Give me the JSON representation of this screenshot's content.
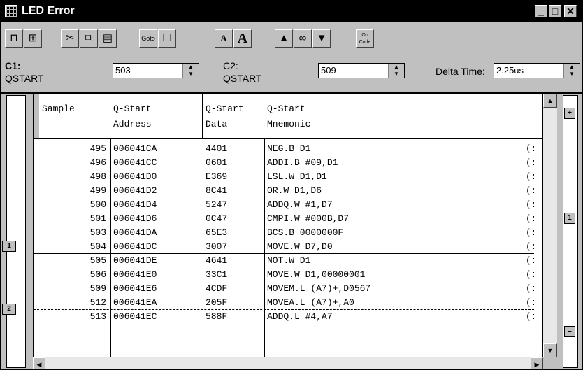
{
  "window": {
    "title": "LED Error"
  },
  "cursor": {
    "c1_label": "C1:",
    "c1_sub": "QSTART",
    "c1_value": "503",
    "c2_label": "C2:",
    "c2_sub": "QSTART",
    "c2_value": "509",
    "delta_label": "Delta Time:",
    "delta_value": "2.25us"
  },
  "columns": [
    {
      "l1": "",
      "l2": "Sample"
    },
    {
      "l1": "Q-Start",
      "l2": "Address"
    },
    {
      "l1": "Q-Start",
      "l2": "Data"
    },
    {
      "l1": "Q-Start",
      "l2": "Mnemonic"
    }
  ],
  "rows": [
    {
      "sample": "495",
      "address": "006041CA",
      "data": "4401",
      "mnemonic": "NEG.B D1",
      "extra": "(:"
    },
    {
      "sample": "496",
      "address": "006041CC",
      "data": "0601",
      "mnemonic": "ADDI.B #09,D1",
      "extra": "(:"
    },
    {
      "sample": "498",
      "address": "006041D0",
      "data": "E369",
      "mnemonic": "LSL.W D1,D1",
      "extra": "(:"
    },
    {
      "sample": "499",
      "address": "006041D2",
      "data": "8C41",
      "mnemonic": "OR.W D1,D6",
      "extra": "(:"
    },
    {
      "sample": "500",
      "address": "006041D4",
      "data": "5247",
      "mnemonic": "ADDQ.W #1,D7",
      "extra": "(:"
    },
    {
      "sample": "501",
      "address": "006041D6",
      "data": "0C47",
      "mnemonic": "CMPI.W #000B,D7",
      "extra": "(:"
    },
    {
      "sample": "503",
      "address": "006041DA",
      "data": "65E3",
      "mnemonic": "BCS.B 0000000F",
      "extra": "(:"
    },
    {
      "sample": "504",
      "address": "006041DC",
      "data": "3007",
      "mnemonic": "MOVE.W D7,D0",
      "extra": "(:"
    },
    {
      "sample": "505",
      "address": "006041DE",
      "data": "4641",
      "mnemonic": "NOT.W D1",
      "extra": "(:"
    },
    {
      "sample": "506",
      "address": "006041E0",
      "data": "33C1",
      "mnemonic": "MOVE.W D1,00000001",
      "extra": "(:"
    },
    {
      "sample": "509",
      "address": "006041E6",
      "data": "4CDF",
      "mnemonic": "MOVEM.L (A7)+,D0567",
      "extra": "(:"
    },
    {
      "sample": "512",
      "address": "006041EA",
      "data": "205F",
      "mnemonic": "MOVEA.L (A7)+,A0",
      "extra": "(:"
    },
    {
      "sample": "513",
      "address": "006041EC",
      "data": "588F",
      "mnemonic": "ADDQ.L #4,A7",
      "extra": "(:"
    }
  ],
  "markers": {
    "m1": "1",
    "m2": "2"
  },
  "toolbar": {
    "font_small": "A",
    "font_large": "A",
    "goto": "Goto",
    "opcode": "Op Code"
  },
  "icons": [
    "window-menu-icon",
    "minimize-icon",
    "maximize-icon",
    "close-icon",
    "insert-column-icon",
    "add-column-icon",
    "cut-icon",
    "copy-icon",
    "paste-icon",
    "goto-icon",
    "properties-icon",
    "font-small-icon",
    "font-large-icon",
    "search-up-icon",
    "binoculars-icon",
    "search-down-icon",
    "opcode-icon"
  ]
}
